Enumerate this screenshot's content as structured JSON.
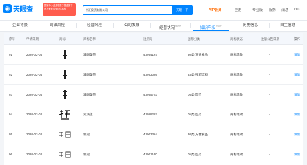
{
  "header": {
    "logo_text": "天眼查",
    "promo_lines": [
      "国家中小企业发展子基金旗下",
      "官方备案企业征信机构"
    ],
    "search_value": "中汇投资有限公司",
    "search_button": "天眼一下",
    "nav": [
      "VIP会员",
      "应用",
      "专业版",
      "服务",
      "消息",
      "TYC"
    ]
  },
  "tabs": [
    {
      "label": "企业背景",
      "count": ""
    },
    {
      "label": "司法风险",
      "count": ""
    },
    {
      "label": "经营风险",
      "count": ""
    },
    {
      "label": "公司发展",
      "count": ""
    },
    {
      "label": "经营状况",
      "count": "999+"
    },
    {
      "label": "知识产权",
      "count": "999+"
    },
    {
      "label": "历史信息",
      "count": ""
    },
    {
      "label": "自主信息",
      "count": ""
    }
  ],
  "table": {
    "columns": [
      "序号",
      "申请日期",
      "商标",
      "商标名称",
      "注册号",
      "国际分类",
      "商标状态",
      "注册公告日期",
      "操作"
    ],
    "rows": [
      {
        "no": "91",
        "date": "2020-02-04",
        "name": "满园美苑",
        "reg": "43994167",
        "cls": "30类-方便食品",
        "status": "商标无效",
        "notice": "-",
        "action": "详情"
      },
      {
        "no": "92",
        "date": "2020-02-04",
        "name": "满园美苑",
        "reg": "43993086",
        "cls": "33类-啤酒饮料",
        "status": "商标无效",
        "notice": "-",
        "action": "详情"
      },
      {
        "no": "93",
        "date": "2020-02-04",
        "name": "满园美苑",
        "reg": "43995753",
        "cls": "05类-医药",
        "status": "商标无效",
        "notice": "-",
        "action": "详情"
      },
      {
        "no": "94",
        "date": "2020-02-03",
        "name": "双满莲",
        "reg": "43988287",
        "cls": "05类-医药",
        "status": "商标无效",
        "notice": "-",
        "action": "详情"
      },
      {
        "no": "95",
        "date": "2020-02-03",
        "name": "新冠",
        "reg": "43963364",
        "cls": "30类-方便食品",
        "status": "商标无效",
        "notice": "-",
        "action": "详情"
      },
      {
        "no": "96",
        "date": "2020-02-03",
        "name": "新冠",
        "reg": "43961160",
        "cls": "05类-医药",
        "status": "商标无效",
        "notice": "-",
        "action": "详情"
      }
    ]
  },
  "colors": {
    "brand": "#0084ff",
    "promo": "#ff5c4d",
    "vip": "#ff6a00"
  }
}
